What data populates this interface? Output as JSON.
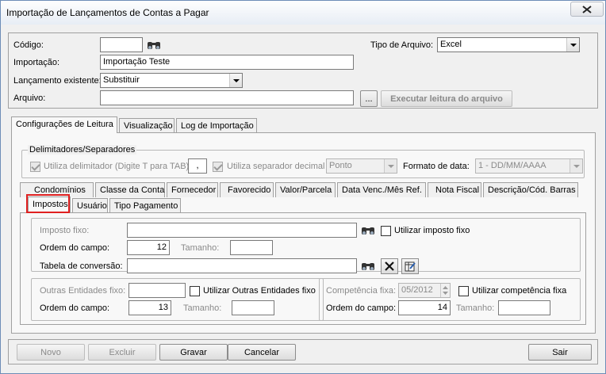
{
  "window": {
    "title": "Importação de Lançamentos de Contas a Pagar"
  },
  "header": {
    "codigo_label": "Código:",
    "codigo_value": "",
    "tipo_arquivo_label": "Tipo de Arquivo:",
    "tipo_arquivo_value": "Excel",
    "importacao_label": "Importação:",
    "importacao_value": "Importação Teste",
    "lancamento_label": "Lançamento existente:",
    "lancamento_value": "Substituir",
    "arquivo_label": "Arquivo:",
    "arquivo_value": "",
    "browse_label": "...",
    "executar_label": "Executar leitura do arquivo"
  },
  "main_tabs": [
    {
      "label": "Configurações de Leitura",
      "active": true
    },
    {
      "label": "Visualização",
      "active": false
    },
    {
      "label": "Log de Importação",
      "active": false
    }
  ],
  "delimitadores": {
    "caption": "Delimitadores/Separadores",
    "utiliza_delimitador_label": "Utiliza delimitador (Digite T para TAB)",
    "delimitador_value": ",",
    "utiliza_separador_label": "Utiliza separador decimal",
    "separador_value": "Ponto",
    "formato_data_label": "Formato de data:",
    "formato_data_value": "1 - DD/MM/AAAA"
  },
  "sub_tabs_row1": [
    "Condomínios",
    "Classe da Conta",
    "Fornecedor",
    "Favorecido",
    "Valor/Parcela",
    "Data Venc./Mês Ref.",
    "Nota Fiscal",
    "Descrição/Cód. Barras"
  ],
  "sub_tabs_row2": [
    {
      "label": "Impostos",
      "active": true
    },
    {
      "label": "Usuário",
      "active": false
    },
    {
      "label": "Tipo Pagamento",
      "active": false
    }
  ],
  "impostos": {
    "imposto_fixo_label": "Imposto fixo:",
    "imposto_fixo_value": "",
    "utilizar_imposto_fixo_label": "Utilizar imposto fixo",
    "ordem_label": "Ordem do campo:",
    "ordem_value": "12",
    "tamanho_label": "Tamanho:",
    "tamanho_value": "",
    "tabela_label": "Tabela de conversão:",
    "tabela_value": ""
  },
  "outras": {
    "fixo_label": "Outras Entidades fixo:",
    "fixo_value": "",
    "utilizar_label": "Utilizar Outras Entidades fixo",
    "ordem_label": "Ordem do campo:",
    "ordem_value": "13",
    "tamanho_label": "Tamanho:",
    "tamanho_value": ""
  },
  "competencia": {
    "fixa_label": "Competência fixa:",
    "fixa_value": "05/2012",
    "utilizar_label": "Utilizar competência fixa",
    "ordem_label": "Ordem do campo:",
    "ordem_value": "14",
    "tamanho_label": "Tamanho:",
    "tamanho_value": ""
  },
  "footer": {
    "novo": "Novo",
    "excluir": "Excluir",
    "gravar": "Gravar",
    "cancelar": "Cancelar",
    "sair": "Sair"
  },
  "colors": {
    "highlight": "#e02020",
    "title_gradient_end": "#e7edf5"
  }
}
